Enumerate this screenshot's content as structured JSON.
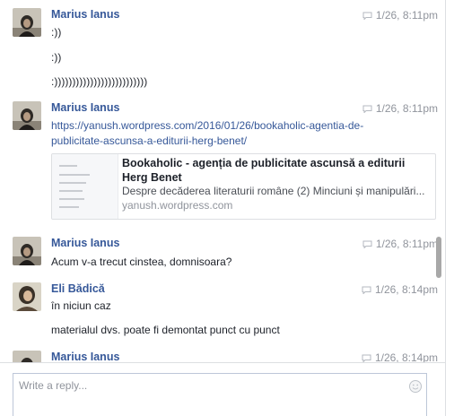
{
  "messages": [
    {
      "author": "Marius Ianus",
      "time": "1/26, 8:11pm",
      "lines": [
        ":))",
        ":))",
        ":))))))))))))))))))))))))))"
      ]
    },
    {
      "author": "Marius Ianus",
      "time": "1/26, 8:11pm",
      "link_lines": [
        "https://yanush.wordpress.com/2016/01/26/bookaholic-agentia-de-",
        "publicitate-ascunsa-a-editurii-herg-benet/"
      ],
      "preview": {
        "title": "Bookaholic - agenția de publicitate ascunsă a editurii Herg Benet",
        "description": "Despre decăderea literaturii române (2) Minciuni și manipulări...",
        "domain": "yanush.wordpress.com"
      }
    },
    {
      "author": "Marius Ianus",
      "time": "1/26, 8:11pm",
      "lines": [
        "Acum v-a trecut cinstea, domnisoara?"
      ]
    },
    {
      "author": "Eli Bădică",
      "time": "1/26, 8:14pm",
      "lines": [
        "în niciun caz",
        "materialul dvs. poate fi demontat punct cu punct"
      ]
    },
    {
      "author": "Marius Ianus",
      "time": "1/26, 8:14pm",
      "lines": []
    }
  ],
  "composer": {
    "placeholder": "Write a reply..."
  },
  "icons": {
    "timestamp": "speech-bubble-icon",
    "emoji": "smiley-icon"
  },
  "colors": {
    "link": "#365899",
    "meta": "#90949c",
    "text": "#1d2129"
  }
}
